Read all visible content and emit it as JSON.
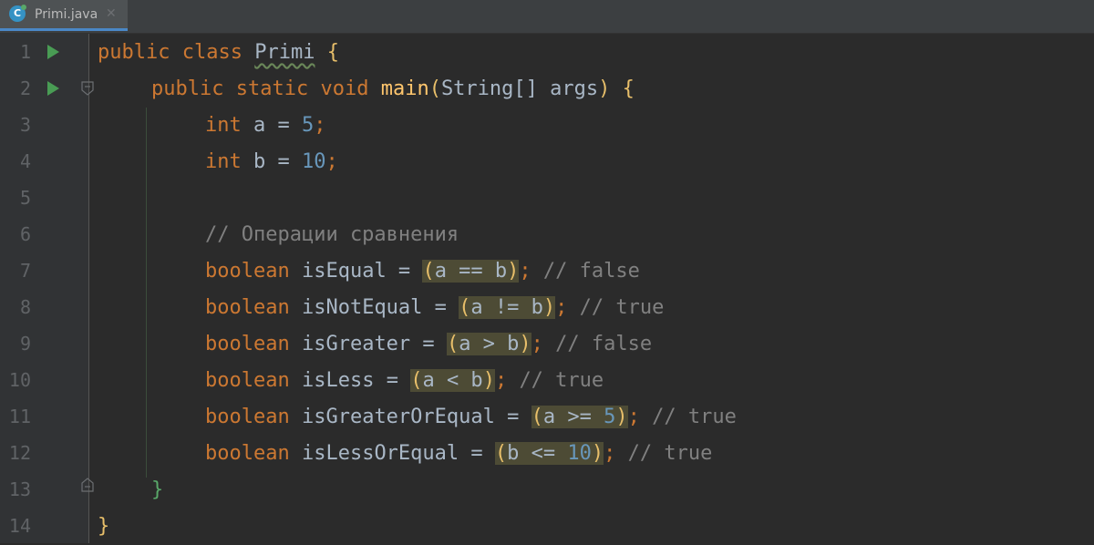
{
  "tab": {
    "title": "Primi.java",
    "close": "✕",
    "icon_letter": "C",
    "icon_name": "java-class-icon"
  },
  "gutter": {
    "line_numbers": [
      "1",
      "2",
      "3",
      "4",
      "5",
      "6",
      "7",
      "8",
      "9",
      "10",
      "11",
      "12",
      "13",
      "14"
    ]
  },
  "code": {
    "l1": {
      "kw1": "public",
      "kw2": "class",
      "name": "Primi",
      "brace": "{"
    },
    "l2": {
      "kw1": "public",
      "kw2": "static",
      "kw3": "void",
      "fn": "main",
      "paren_open": "(",
      "args": "String[] args",
      "paren_close": ")",
      "brace": "{"
    },
    "l3": {
      "type": "int",
      "rest": "a = ",
      "num": "5",
      "semi": ";"
    },
    "l4": {
      "type": "int",
      "rest": "b = ",
      "num": "10",
      "semi": ";"
    },
    "l6": {
      "comment": "// Операции сравнения"
    },
    "l7": {
      "type": "boolean",
      "name": "isEqual",
      "eq": " = ",
      "po": "(",
      "expr": "a == b",
      "pc": ")",
      "semi": ";",
      "comment": "// false"
    },
    "l8": {
      "type": "boolean",
      "name": "isNotEqual",
      "eq": " = ",
      "po": "(",
      "expr": "a != b",
      "pc": ")",
      "semi": ";",
      "comment": "// true"
    },
    "l9": {
      "type": "boolean",
      "name": "isGreater",
      "eq": " = ",
      "po": "(",
      "expr": "a > b",
      "pc": ")",
      "semi": ";",
      "comment": "// false"
    },
    "l10": {
      "type": "boolean",
      "name": "isLess",
      "eq": " = ",
      "po": "(",
      "expr": "a < b",
      "pc": ")",
      "semi": ";",
      "comment": "// true"
    },
    "l11": {
      "type": "boolean",
      "name": "isGreaterOrEqual",
      "eq": " = ",
      "po": "(",
      "expr": "a >= ",
      "num": "5",
      "pc": ")",
      "semi": ";",
      "comment": "// true"
    },
    "l12": {
      "type": "boolean",
      "name": "isLessOrEqual",
      "eq": " = ",
      "po": "(",
      "expr": "b <= ",
      "num": "10",
      "pc": ")",
      "semi": ";",
      "comment": "// true"
    },
    "l13": {
      "brace": "}"
    },
    "l14": {
      "brace": "}"
    }
  },
  "colors": {
    "background": "#2b2b2b",
    "keyword": "#cc7832",
    "number": "#6897bb",
    "comment": "#808080",
    "method": "#ffc66d",
    "highlight": "#4d4b35",
    "run": "#499c54"
  }
}
